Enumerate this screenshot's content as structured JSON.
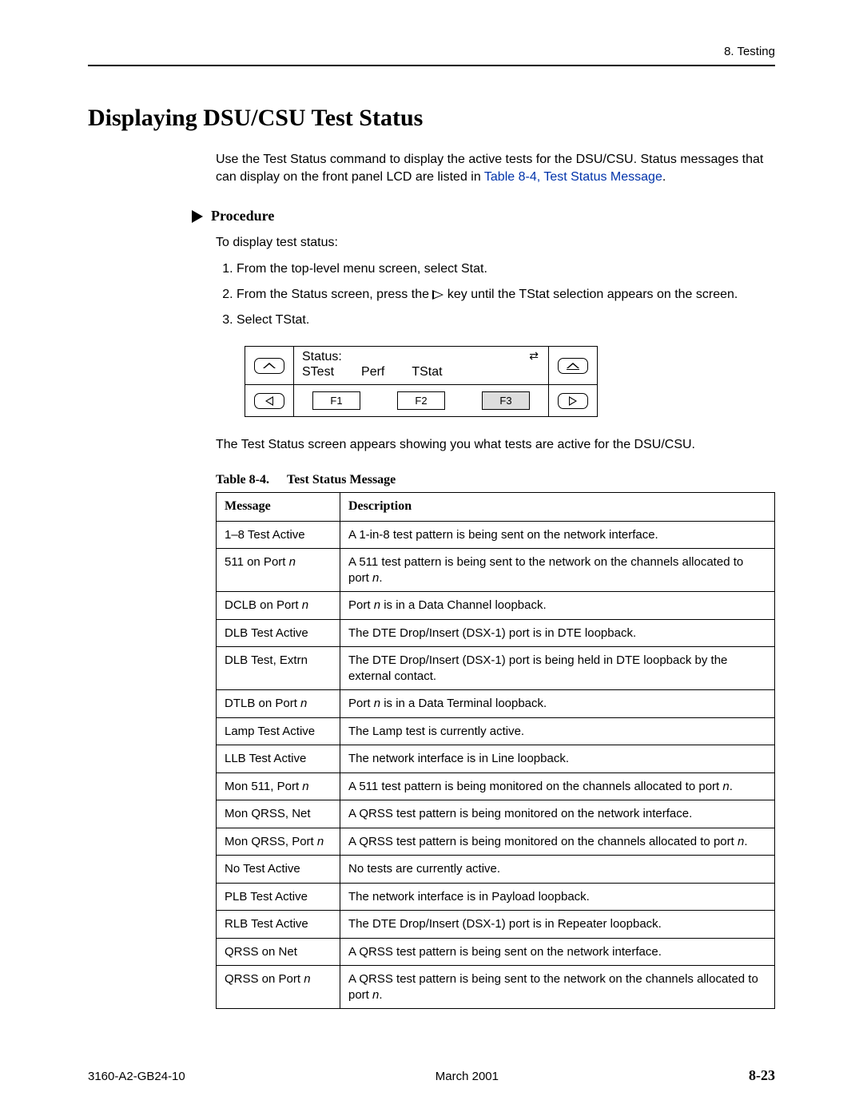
{
  "header": {
    "chapter": "8. Testing"
  },
  "title": "Displaying DSU/CSU Test Status",
  "intro": {
    "text_before_link": "Use the Test Status command to display the active tests for the DSU/CSU. Status messages that can display on the front panel LCD are listed in ",
    "link_text": "Table 8-4, Test Status Message",
    "text_after_link": "."
  },
  "procedure": {
    "heading": "Procedure",
    "lead": "To display test status:",
    "steps": [
      "From the top-level menu screen, select Stat.",
      "From the Status screen, press the {tri} key until the TStat selection appears on the screen.",
      "Select TStat."
    ]
  },
  "lcd": {
    "line1": "Status:",
    "options": [
      "STest",
      "Perf",
      "TStat"
    ],
    "keys": [
      "F1",
      "F2",
      "F3"
    ],
    "selected_key_index": 2
  },
  "result_text": "The Test Status screen appears showing you what tests are active for the DSU/CSU.",
  "table": {
    "caption_label": "Table 8-4.",
    "caption_title": "Test Status Message",
    "headers": [
      "Message",
      "Description"
    ],
    "rows": [
      {
        "msg": "1–8 Test Active",
        "desc": "A 1-in-8 test pattern is being sent on the network interface."
      },
      {
        "msg": "511 on Port {n}",
        "desc": "A 511 test pattern is being sent to the network on the channels allocated to port {n}."
      },
      {
        "msg": "DCLB on Port {n}",
        "desc": "Port {n} is in a Data Channel loopback."
      },
      {
        "msg": "DLB Test Active",
        "desc": "The DTE Drop/Insert (DSX-1) port is in DTE loopback."
      },
      {
        "msg": "DLB Test, Extrn",
        "desc": "The DTE Drop/Insert (DSX-1) port is being held in DTE loopback by the external contact."
      },
      {
        "msg": "DTLB on Port {n}",
        "desc": "Port {n} is in a Data Terminal loopback."
      },
      {
        "msg": "Lamp Test Active",
        "desc": "The Lamp test is currently active."
      },
      {
        "msg": "LLB Test Active",
        "desc": "The network interface is in Line loopback."
      },
      {
        "msg": "Mon 511, Port {n}",
        "desc": "A 511 test pattern is being monitored on the channels allocated to port {n}."
      },
      {
        "msg": "Mon QRSS, Net",
        "desc": "A QRSS test pattern is being monitored on the network interface."
      },
      {
        "msg": "Mon QRSS, Port {n}",
        "desc": "A QRSS test pattern is being monitored on the channels allocated to port {n}."
      },
      {
        "msg": "No Test Active",
        "desc": "No tests are currently active."
      },
      {
        "msg": "PLB Test Active",
        "desc": "The network interface is in Payload loopback."
      },
      {
        "msg": "RLB Test Active",
        "desc": "The DTE Drop/Insert (DSX-1) port is in Repeater loopback."
      },
      {
        "msg": "QRSS on Net",
        "desc": "A QRSS test pattern is being sent on the network interface."
      },
      {
        "msg": "QRSS on Port {n}",
        "desc": "A QRSS test pattern is being sent to the network on the channels allocated to port {n}."
      }
    ]
  },
  "footer": {
    "doc_id": "3160-A2-GB24-10",
    "date": "March 2001",
    "page": "8-23"
  }
}
